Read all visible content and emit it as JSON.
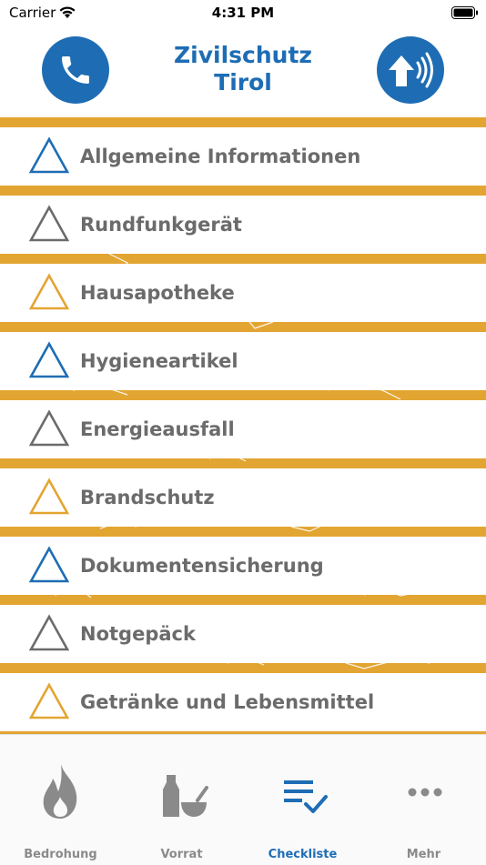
{
  "status_bar": {
    "carrier": "Carrier",
    "time": "4:31 PM"
  },
  "header": {
    "title_line1": "Zivilschutz",
    "title_line2": "Tirol",
    "left_button_icon": "phone-icon",
    "right_button_icon": "siren-speaker-icon"
  },
  "colors": {
    "brand_blue": "#1e6db4",
    "accent_orange": "#e3a532",
    "gray": "#6b6b6b"
  },
  "checklist": {
    "items": [
      {
        "label": "Allgemeine Informationen",
        "icon_color": "blue"
      },
      {
        "label": "Rundfunkgerät",
        "icon_color": "gray"
      },
      {
        "label": "Hausapotheke",
        "icon_color": "orange"
      },
      {
        "label": "Hygieneartikel",
        "icon_color": "blue"
      },
      {
        "label": "Energieausfall",
        "icon_color": "gray"
      },
      {
        "label": "Brandschutz",
        "icon_color": "orange"
      },
      {
        "label": "Dokumentensicherung",
        "icon_color": "blue"
      },
      {
        "label": "Notgepäck",
        "icon_color": "gray"
      },
      {
        "label": "Getränke und Lebensmittel",
        "icon_color": "orange"
      }
    ]
  },
  "tab_bar": {
    "tabs": [
      {
        "label": "Bedrohung",
        "icon": "flame-icon",
        "active": false
      },
      {
        "label": "Vorrat",
        "icon": "bottle-mortar-icon",
        "active": false
      },
      {
        "label": "Checkliste",
        "icon": "checklist-icon",
        "active": true
      },
      {
        "label": "Mehr",
        "icon": "more-dots-icon",
        "active": false
      }
    ]
  }
}
